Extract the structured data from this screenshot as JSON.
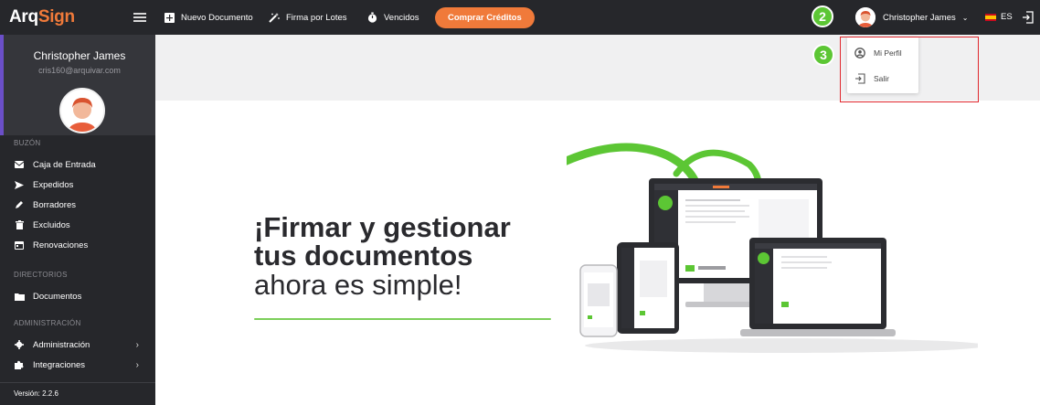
{
  "sidebar": {
    "logo_main": "Arq",
    "logo_accent": "Sign",
    "user": {
      "name": "Christopher James",
      "email": "cris160@arquivar.com"
    },
    "sections": {
      "buzon": "BUZÓN",
      "directorios": "DIRECTORIOS",
      "administracion": "ADMINISTRACIÓN"
    },
    "buzon_items": [
      {
        "label": "Caja de Entrada",
        "icon": "envelope-icon"
      },
      {
        "label": "Expedidos",
        "icon": "send-icon"
      },
      {
        "label": "Borradores",
        "icon": "pencil-icon"
      },
      {
        "label": "Excluidos",
        "icon": "trash-icon"
      },
      {
        "label": "Renovaciones",
        "icon": "calendar-icon"
      }
    ],
    "directorios_items": [
      {
        "label": "Documentos",
        "icon": "folder-icon"
      }
    ],
    "admin_items": [
      {
        "label": "Administración",
        "icon": "gear-icon"
      },
      {
        "label": "Integraciones",
        "icon": "puzzle-icon"
      }
    ],
    "version": "Versión: 2.2.6"
  },
  "topbar": {
    "new_document": "Nuevo Documento",
    "batch_sign": "Firma por Lotes",
    "expired": "Vencidos",
    "buy_credits": "Comprar Créditos",
    "user_name": "Christopher James",
    "language": "ES"
  },
  "user_dropdown": {
    "profile": "Mi Perfil",
    "logout": "Salir"
  },
  "annotations": {
    "badge_user": "2",
    "badge_menu": "3"
  },
  "hero": {
    "line1": "¡Firmar y gestionar",
    "line2": "tus documentos",
    "line3": "ahora es simple!"
  },
  "colors": {
    "sidebar_bg": "#26272b",
    "accent_orange": "#f07a3a",
    "accent_green": "#5cc634",
    "annotation_red": "#e0272d",
    "content_bg": "#f0f0f1"
  }
}
